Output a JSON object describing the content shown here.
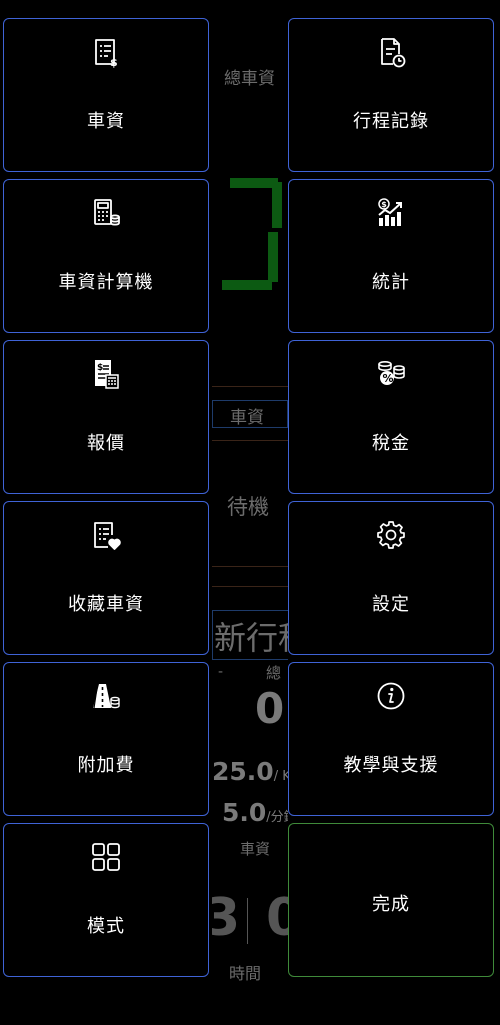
{
  "menu": {
    "fare": "車資",
    "trip_records": "行程記錄",
    "fare_calculator": "車資計算機",
    "statistics": "統計",
    "quote": "報價",
    "tax": "稅金",
    "favorite_fares": "收藏車資",
    "settings": "設定",
    "surcharge": "附加費",
    "tutorial_support": "教學與支援",
    "mode": "模式",
    "done": "完成"
  },
  "background": {
    "total_fare_label": "總車資",
    "fare_label": "車資",
    "status": "待機",
    "new_trip": "新行程",
    "dash": "-",
    "total_short": "總",
    "total_value": "0",
    "rate_km": "25.0",
    "unit_km": "/ Km",
    "rate_min": "5.0",
    "unit_min": "/分鐘",
    "fare_label2": "車資",
    "time_digit_left": "3",
    "time_digit_right": "0",
    "time_label": "時間"
  },
  "colors": {
    "tile_border": "#3f63d6",
    "done_border": "#3f8a3a",
    "meter_digit": "#0c5a12"
  }
}
